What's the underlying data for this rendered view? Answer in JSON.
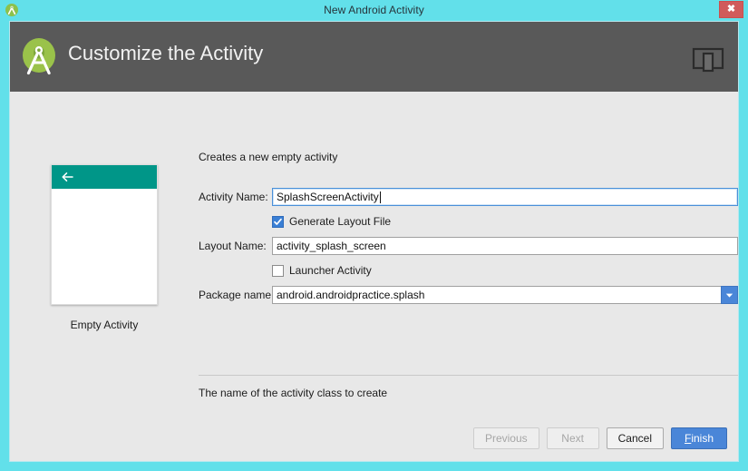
{
  "window": {
    "title": "New Android Activity",
    "app_icon": "android-studio-icon",
    "close_label": "✖",
    "frame_color": "#62e0ea"
  },
  "banner": {
    "heading": "Customize the Activity",
    "logo_icon": "android-studio-logo",
    "device_icon": "device-preview-icon",
    "background_color": "#595959"
  },
  "body": {
    "hint": "Creates a new empty activity",
    "help": "The name of the activity class to create"
  },
  "preview": {
    "label": "Empty Activity",
    "appbar_color": "#009688",
    "back_icon": "back-arrow-icon"
  },
  "form": {
    "activity_name": {
      "label": "Activity Name:",
      "value": "SplashScreenActivity",
      "focused": true
    },
    "generate_layout": {
      "label": "Generate Layout File",
      "checked": true,
      "check_glyph": "✓"
    },
    "layout_name": {
      "label": "Layout Name:",
      "value": "activity_splash_screen"
    },
    "launcher_activity": {
      "label": "Launcher Activity",
      "checked": false
    },
    "package_name": {
      "label": "Package name:",
      "value": "android.androidpractice.splash",
      "dropdown_icon": "chevron-down-icon"
    }
  },
  "buttons": {
    "previous": {
      "label": "Previous",
      "enabled": false
    },
    "next": {
      "label": "Next",
      "enabled": false
    },
    "cancel": {
      "label": "Cancel",
      "enabled": true
    },
    "finish": {
      "label": "Finish",
      "mnemonic": "F",
      "rest": "inish",
      "enabled": true,
      "color": "#4a86d8"
    }
  }
}
